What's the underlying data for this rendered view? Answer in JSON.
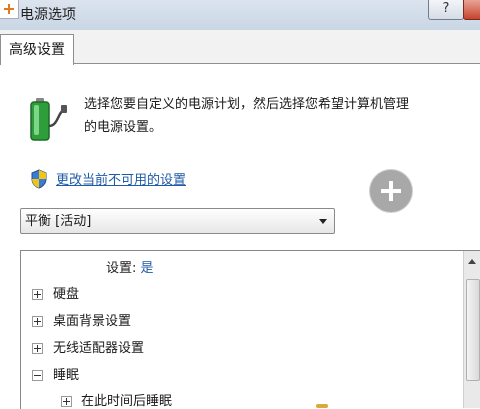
{
  "window": {
    "title": "电源选项",
    "help_label": "?"
  },
  "tabs": [
    {
      "label": "高级设置"
    }
  ],
  "description": {
    "line1": "选择您要自定义的电源计划，然后选择您希望计算机管理",
    "line2": "的电源设置。"
  },
  "change_link": "更改当前不可用的设置",
  "plan_select": {
    "value": "平衡 [活动]"
  },
  "settings": {
    "key": "设置:",
    "value": "是",
    "tree": [
      {
        "label": "硬盘",
        "expander": "+"
      },
      {
        "label": "桌面背景设置",
        "expander": "+"
      },
      {
        "label": "无线适配器设置",
        "expander": "+"
      },
      {
        "label": "睡眠",
        "expander": "-"
      },
      {
        "label": "在此时间后睡眠",
        "expander": "+"
      }
    ]
  },
  "icons": {
    "app": "power-options-icon",
    "battery": "battery-plug-icon",
    "shield": "uac-shield-icon",
    "add": "add-icon"
  },
  "colors": {
    "link": "#1f5ba8",
    "battery_green": "#2e9e3a",
    "add_circle": "#a8a8a8"
  }
}
